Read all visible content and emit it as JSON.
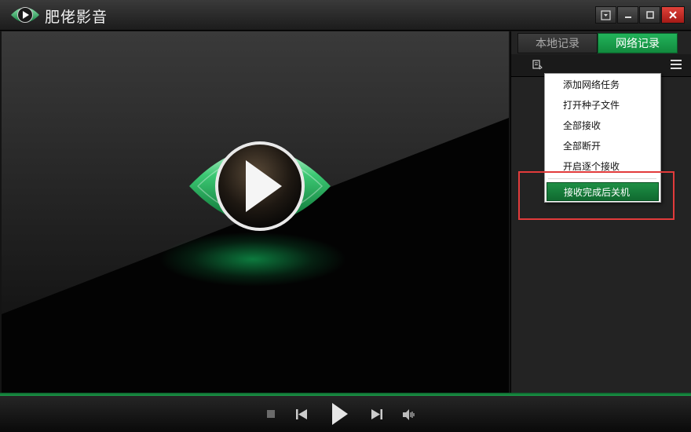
{
  "app": {
    "title": "肥佬影音"
  },
  "colors": {
    "accent_green": "#1aa04a",
    "close_red": "#c42b24",
    "highlight_box": "#e23b3b"
  },
  "panel": {
    "tabs": [
      {
        "label": "本地记录",
        "active": false
      },
      {
        "label": "网络记录",
        "active": true
      }
    ]
  },
  "context_menu": {
    "items": [
      {
        "label": "添加网络任务",
        "highlighted": false
      },
      {
        "label": "打开种子文件",
        "highlighted": false
      },
      {
        "label": "全部接收",
        "highlighted": false
      },
      {
        "label": "全部断开",
        "highlighted": false
      },
      {
        "label": "开启逐个接收",
        "highlighted": false
      },
      {
        "label": "接收完成后关机",
        "highlighted": true
      }
    ]
  },
  "icons": {
    "window": [
      "dropdown-menu-icon",
      "minimize-icon",
      "maximize-icon",
      "close-icon"
    ],
    "toolbar": [
      "import-list-icon",
      "menu-icon"
    ],
    "playback": [
      "stop-icon",
      "previous-icon",
      "play-icon",
      "next-icon",
      "volume-icon"
    ]
  }
}
